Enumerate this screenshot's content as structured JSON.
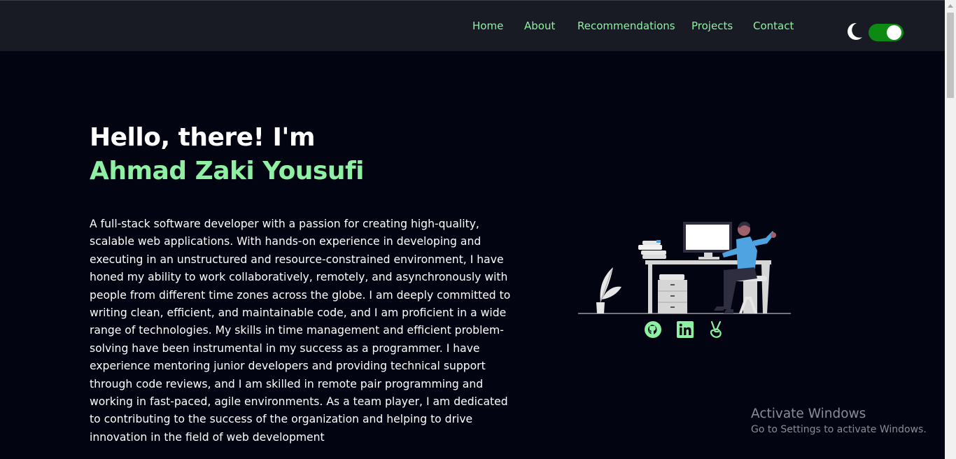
{
  "nav": {
    "items": [
      {
        "label": "Home"
      },
      {
        "label": "About"
      },
      {
        "label": "Recommendations"
      },
      {
        "label": "Projects"
      },
      {
        "label": "Contact"
      }
    ]
  },
  "theme_toggle": {
    "icon": "moon-icon",
    "state": "on",
    "color": "#0d8a14"
  },
  "hero": {
    "greeting": "Hello, there! I'm",
    "name": "Ahmad Zaki Yousufi",
    "bio": "A full-stack software developer with a passion for creating high-quality, scalable web applications. With hands-on experience in developing and executing in an unstructured and resource-constrained environment, I have honed my ability to work collaboratively, remotely, and asynchronously with people from different time zones across the globe. I am deeply committed to writing clean, efficient, and maintainable code, and I am proficient in a wide range of technologies. My skills in time management and efficient problem-solving have been instrumental in my success as a programmer. I have experience mentoring junior developers and providing technical support through code reviews, and I am skilled in remote pair programming and working in fast-paced, agile environments. As a team player, I am dedicated to contributing to the success of the organization and helping to drive innovation in the field of web development"
  },
  "social": {
    "icons": [
      "github-icon",
      "linkedin-icon",
      "angellist-icon"
    ]
  },
  "watermark": {
    "title": "Activate Windows",
    "subtitle": "Go to Settings to activate Windows."
  },
  "colors": {
    "background": "#030412",
    "navbar": "#181a24",
    "accent": "#8ff0a4",
    "toggle": "#0d8a14"
  }
}
